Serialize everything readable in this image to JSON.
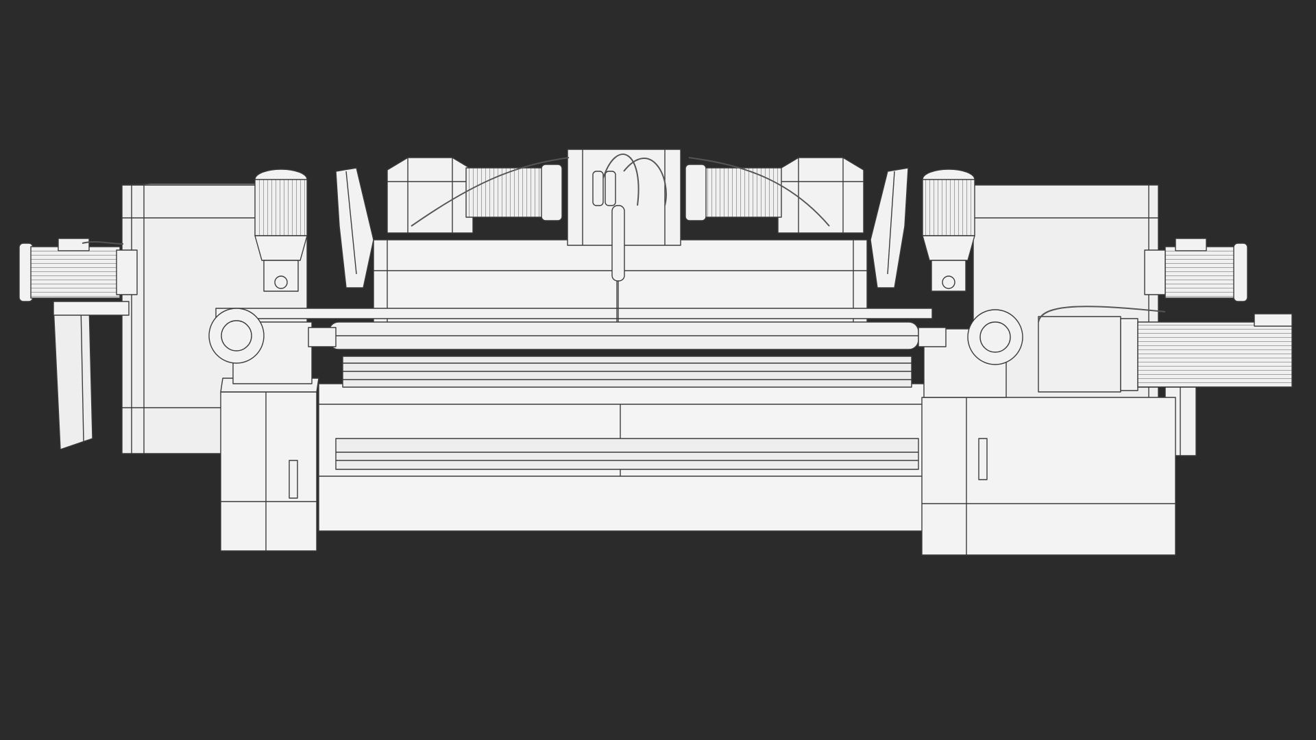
{
  "scene": {
    "background_color": "#2b2b2b",
    "model_fill": "#f2f2f2",
    "model_shade": "#e2e2e2",
    "wire_color": "#3a3a3a",
    "subject": "veneer-peeling-lathe-wireframe"
  }
}
